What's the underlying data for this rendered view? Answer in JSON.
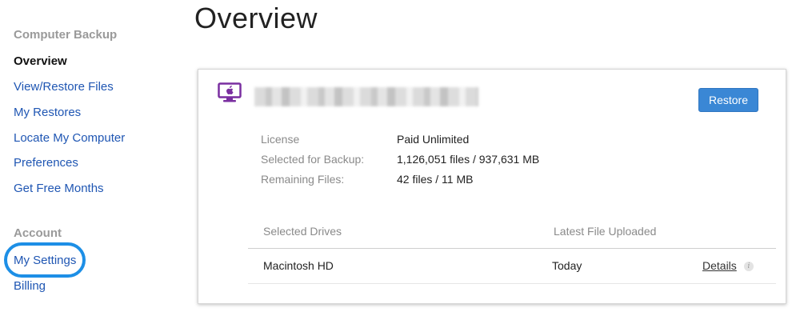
{
  "sidebar": {
    "backup_heading": "Computer Backup",
    "backup_items": [
      {
        "label": "Overview"
      },
      {
        "label": "View/Restore Files"
      },
      {
        "label": "My Restores"
      },
      {
        "label": "Locate My Computer"
      },
      {
        "label": "Preferences"
      },
      {
        "label": "Get Free Months"
      }
    ],
    "account_heading": "Account",
    "account_items": [
      {
        "label": "My Settings"
      },
      {
        "label": "Billing"
      }
    ]
  },
  "main": {
    "title": "Overview",
    "card": {
      "restore_label": "Restore",
      "info": [
        {
          "label": "License",
          "value": "Paid Unlimited"
        },
        {
          "label": "Selected for Backup:",
          "value": "1,126,051 files / 937,631 MB"
        },
        {
          "label": "Remaining Files:",
          "value": "42 files / 11 MB"
        }
      ],
      "drives": {
        "col_drive": "Selected Drives",
        "col_latest": "Latest File Uploaded",
        "rows": [
          {
            "name": "Macintosh HD",
            "latest": "Today",
            "details": "Details"
          }
        ]
      }
    }
  },
  "colors": {
    "link": "#1f56b3",
    "highlight": "#1d8fe6",
    "button": "#3a87d5",
    "icon": "#7a2fa0"
  },
  "icons": {
    "computer": "monitor-icon",
    "info": "info-icon"
  }
}
